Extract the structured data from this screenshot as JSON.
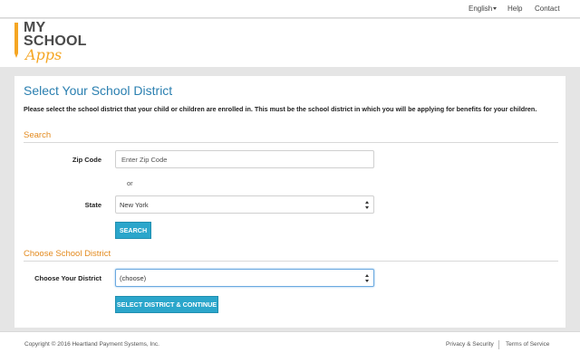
{
  "topnav": {
    "language": "English",
    "help": "Help",
    "contact": "Contact"
  },
  "logo": {
    "line1": "MY",
    "line2": "SCHOOL",
    "line3": "Apps"
  },
  "page": {
    "title": "Select Your School District",
    "intro": "Please select the school district that your child or children are enrolled in. This must be the school district in which you will be applying for benefits for your children."
  },
  "search": {
    "heading": "Search",
    "zip_label": "Zip Code",
    "zip_placeholder": "Enter Zip Code",
    "or_text": "or",
    "state_label": "State",
    "state_value": "New York",
    "search_button": "SEARCH"
  },
  "choose": {
    "heading": "Choose School District",
    "district_label": "Choose Your District",
    "district_value": "(choose)",
    "continue_button": "SELECT DISTRICT & CONTINUE"
  },
  "footer": {
    "copyright": "Copyright © 2016 Heartland Payment Systems, Inc.",
    "privacy": "Privacy & Security",
    "terms": "Terms of Service"
  }
}
